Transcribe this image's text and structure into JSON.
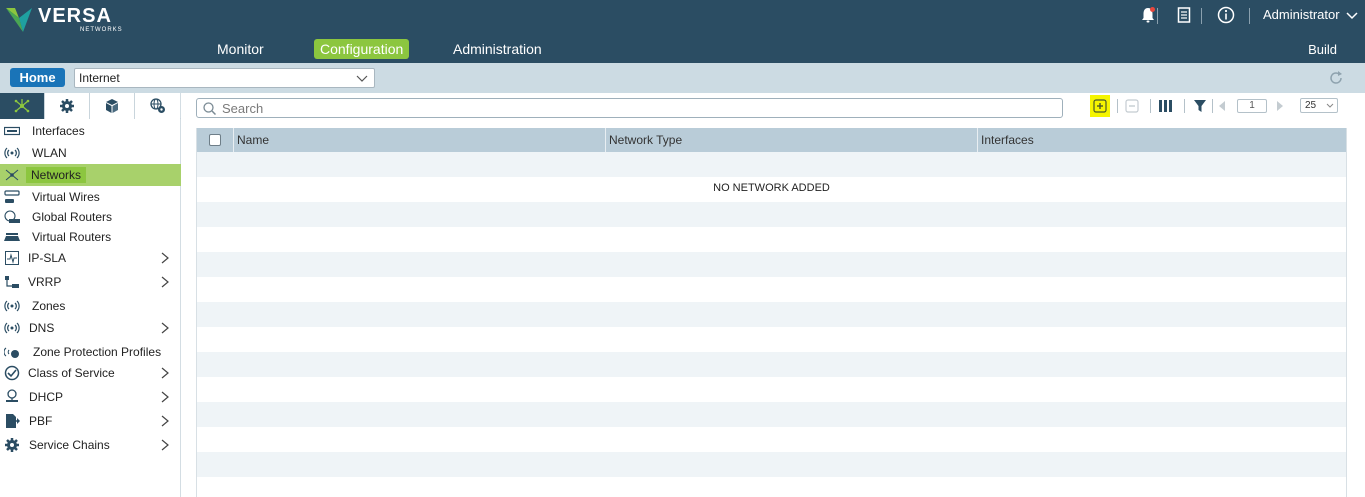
{
  "brand": {
    "name": "VERSA",
    "sub": "NETWORKS"
  },
  "nav": {
    "monitor": "Monitor",
    "configuration": "Configuration",
    "administration": "Administration",
    "build": "Build"
  },
  "user": {
    "name": "Administrator"
  },
  "icons": {
    "bell": "bell-icon",
    "notes": "document-icon",
    "info": "info-icon",
    "refresh": "refresh-icon"
  },
  "colors": {
    "header": "#2b4d63",
    "accent": "#8cc63f",
    "home_button": "#1a74b8",
    "highlight": "#f5f500"
  },
  "subbar": {
    "home": "Home",
    "org_selected": "Internet"
  },
  "sidebar": {
    "items": [
      {
        "label": "Interfaces",
        "icon": "interfaces-icon"
      },
      {
        "label": "WLAN",
        "icon": "wifi-icon"
      },
      {
        "label": "Networks",
        "icon": "network-icon",
        "active": true
      },
      {
        "label": "Virtual Wires",
        "icon": "virtual-wires-icon"
      },
      {
        "label": "Global Routers",
        "icon": "global-router-icon"
      },
      {
        "label": "Virtual Routers",
        "icon": "virtual-router-icon"
      },
      {
        "label": "IP-SLA",
        "icon": "ip-sla-icon",
        "expandable": true
      },
      {
        "label": "VRRP",
        "icon": "vrrp-icon",
        "expandable": true
      },
      {
        "label": "Zones",
        "icon": "zones-icon"
      },
      {
        "label": "DNS",
        "icon": "dns-icon",
        "expandable": true
      },
      {
        "label": "Zone Protection Profiles",
        "icon": "zone-protection-icon"
      },
      {
        "label": "Class of Service",
        "icon": "class-of-service-icon",
        "expandable": true
      },
      {
        "label": "DHCP",
        "icon": "dhcp-icon",
        "expandable": true
      },
      {
        "label": "PBF",
        "icon": "pbf-icon",
        "expandable": true
      },
      {
        "label": "Service Chains",
        "icon": "service-chains-icon",
        "expandable": true
      }
    ]
  },
  "search": {
    "placeholder": "Search"
  },
  "pager": {
    "page": "1",
    "page_size": "25"
  },
  "table": {
    "columns": [
      "Name",
      "Network Type",
      "Interfaces"
    ],
    "empty_message": "NO NETWORK ADDED"
  }
}
